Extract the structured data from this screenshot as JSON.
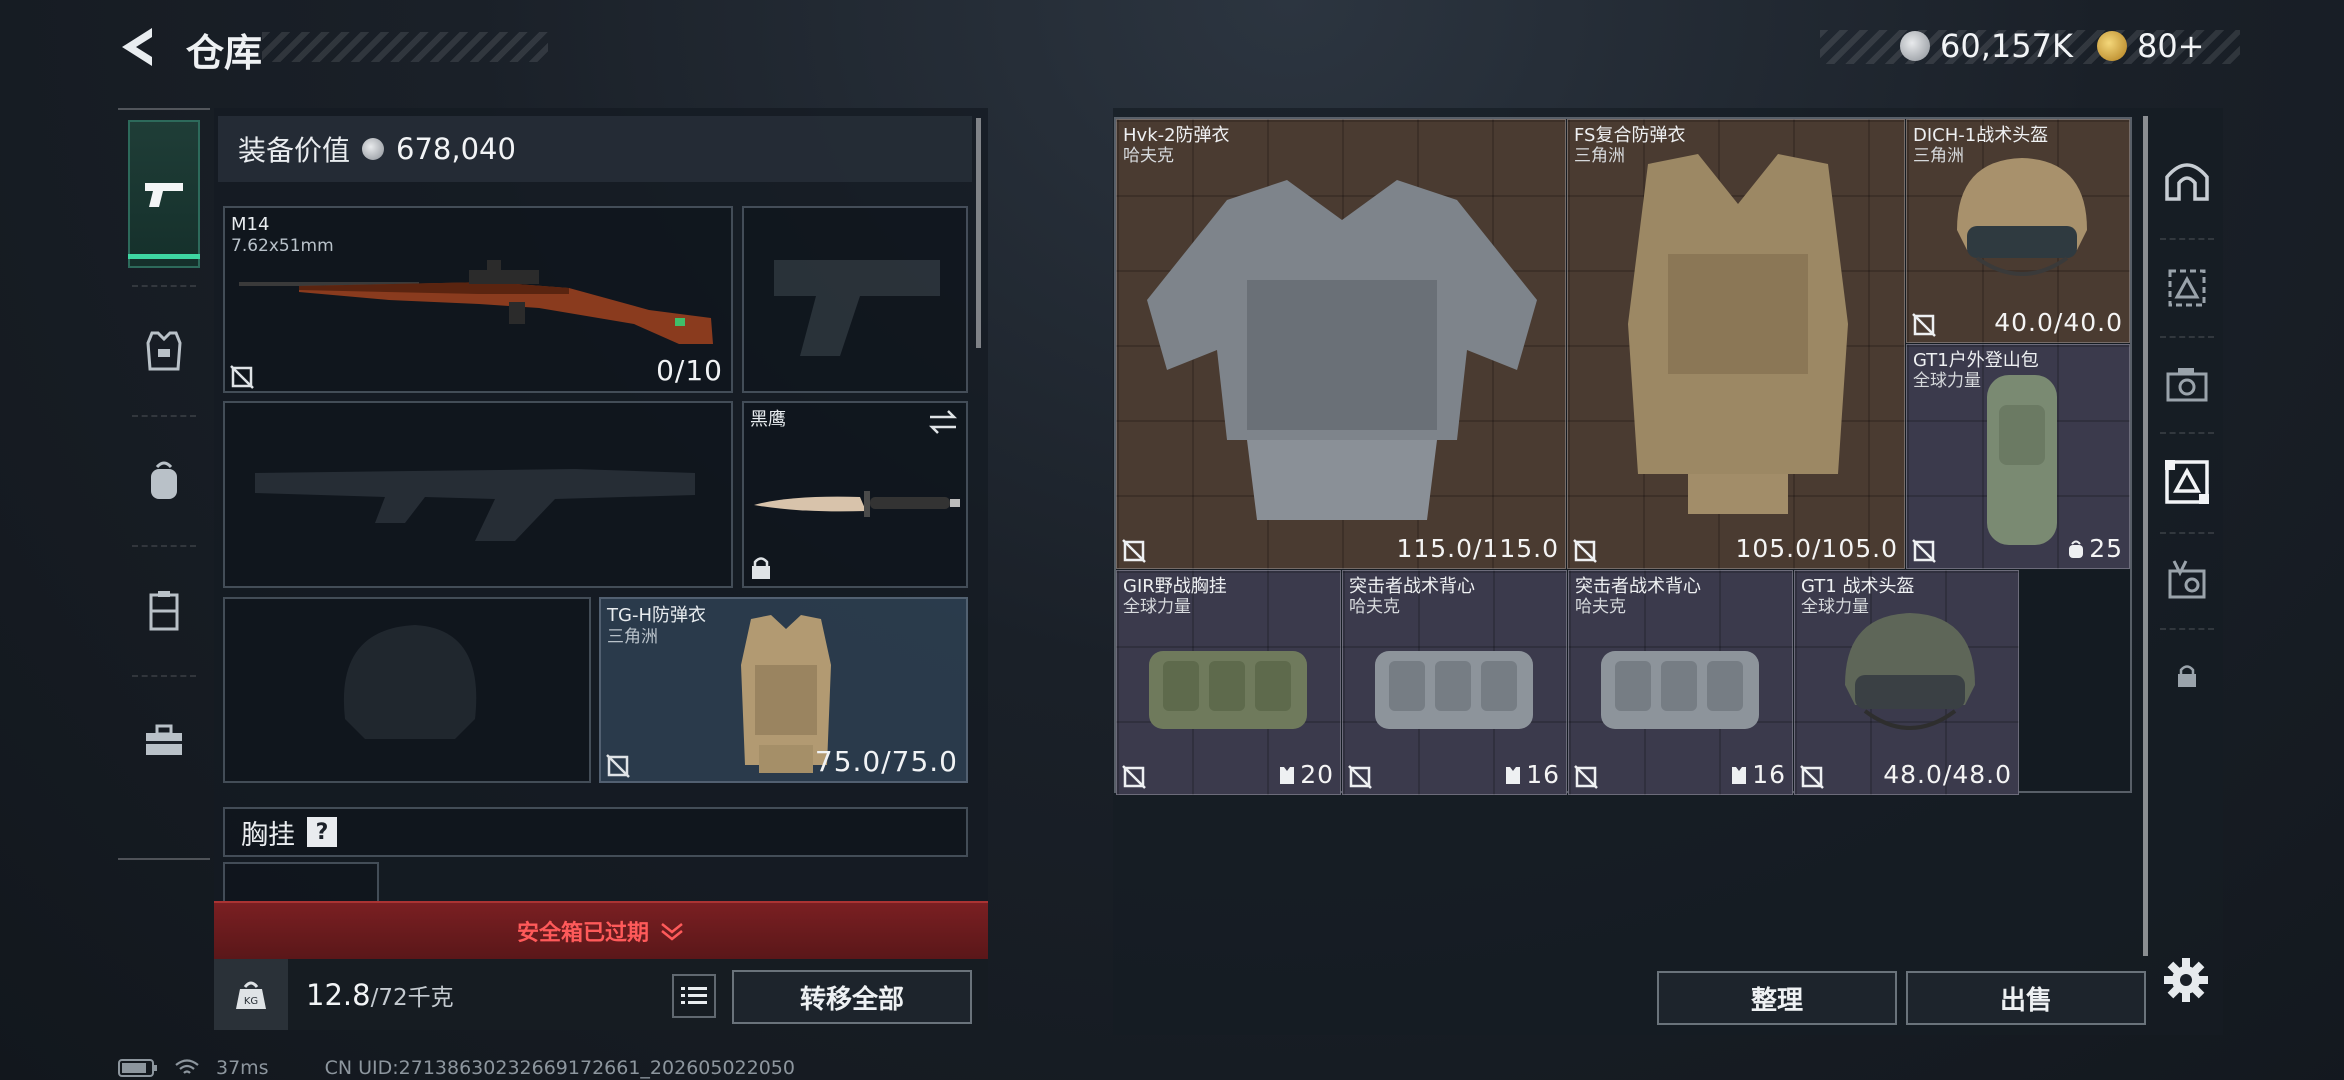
{
  "header": {
    "title": "仓库",
    "currency1_value": "60,157K",
    "currency2_value": "80+"
  },
  "equipment": {
    "value_label": "装备价值",
    "value": "678,040",
    "primary_weapon": {
      "name": "M14",
      "caliber": "7.62x51mm",
      "ammo": "0/10"
    },
    "melee": {
      "name": "黑鹰"
    },
    "armor": {
      "name": "TG-H防弹衣",
      "map": "三角洲",
      "durability": "75.0/75.0"
    },
    "chest_rig_label": "胸挂",
    "chest_rig_help": "?",
    "safe_box_expired": "安全箱已过期",
    "weight_current": "12.8",
    "weight_max": "/72千克",
    "transfer_all": "转移全部"
  },
  "stash": {
    "items": [
      {
        "name": "Hvk-2防弹衣",
        "sub": "哈夫克",
        "value": "115.0/115.0"
      },
      {
        "name": "FS复合防弹衣",
        "sub": "三角洲",
        "value": "105.0/105.0"
      },
      {
        "name": "DICH-1战术头盔",
        "sub": "三角洲",
        "value": "40.0/40.0"
      },
      {
        "name": "GT1户外登山包",
        "sub": "全球力量",
        "value": "25"
      },
      {
        "name": "GIR野战胸挂",
        "sub": "全球力量",
        "value": "20"
      },
      {
        "name": "突击者战术背心",
        "sub": "哈夫克",
        "value": "16"
      },
      {
        "name": "突击者战术背心",
        "sub": "哈夫克",
        "value": "16"
      },
      {
        "name": "GT1 战术头盔",
        "sub": "全球力量",
        "value": "48.0/48.0"
      }
    ],
    "sort_button": "整理",
    "sell_button": "出售"
  },
  "status_bar": {
    "ping": "37ms",
    "uid": "CN UID:27138630232669172661_202605022050"
  },
  "colors": {
    "accent_green": "#3ed6a2",
    "alert_red": "#ff4d4d",
    "alert_bg": "#6e1d1f"
  }
}
